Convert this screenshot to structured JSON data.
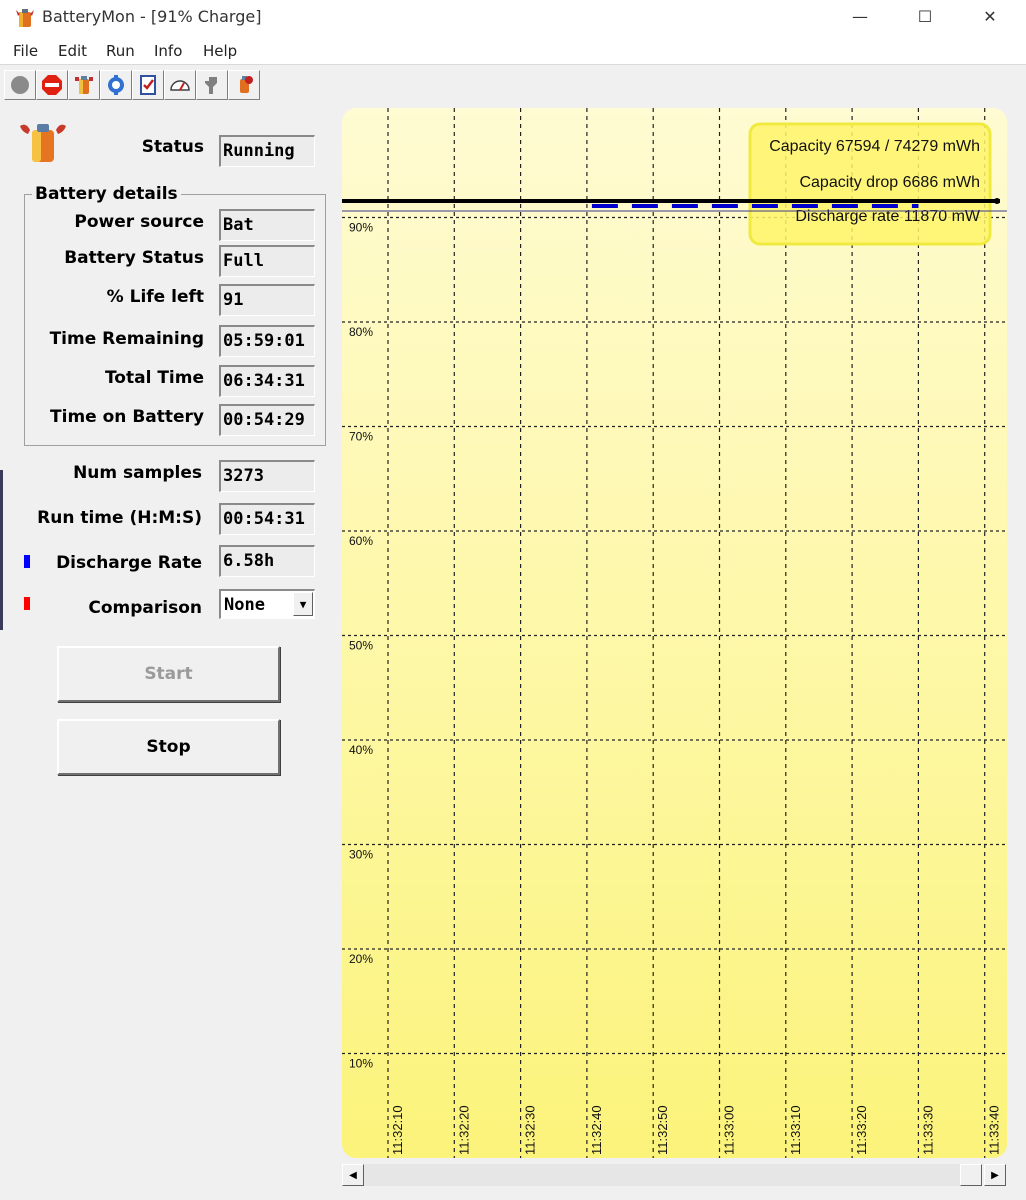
{
  "window": {
    "title": "BatteryMon - [91% Charge]",
    "minimize_glyph": "—",
    "maximize_glyph": "☐",
    "close_glyph": "✕"
  },
  "menu": [
    "File",
    "Edit",
    "Run",
    "Info",
    "Help"
  ],
  "toolbar": [
    "record-icon",
    "stop-icon",
    "battery-icon",
    "settings-icon",
    "checklist-icon",
    "gauge-icon",
    "plug-icon",
    "battery-info-icon"
  ],
  "status": {
    "label": "Status",
    "value": "Running"
  },
  "battery_details": {
    "title": "Battery details",
    "fields": [
      {
        "label": "Power source",
        "value": "Bat"
      },
      {
        "label": "Battery Status",
        "value": "Full"
      },
      {
        "label": "% Life left",
        "value": "91"
      },
      {
        "label": "Time Remaining",
        "value": "05:59:01"
      },
      {
        "label": "Total Time",
        "value": "06:34:31"
      },
      {
        "label": "Time on Battery",
        "value": "00:54:29"
      }
    ]
  },
  "stats": {
    "num_samples": {
      "label": "Num samples",
      "value": "3273"
    },
    "run_time": {
      "label": "Run time (H:M:S)",
      "value": "00:54:31"
    },
    "discharge_rate": {
      "label": "Discharge Rate",
      "value": "6.58h",
      "color": "#0000ff"
    },
    "comparison": {
      "label": "Comparison",
      "value": "None",
      "color": "#ff0000"
    }
  },
  "buttons": {
    "start": "Start",
    "stop": "Stop"
  },
  "colors": {
    "chart_top": "#fffbd2",
    "chart_bottom": "#fbf37a",
    "legend_box": "#fff56a"
  },
  "chart_data": {
    "type": "line",
    "y_ticks": [
      "90%",
      "80%",
      "70%",
      "60%",
      "50%",
      "40%",
      "30%",
      "20%",
      "10%"
    ],
    "y_tick_values": [
      90,
      80,
      70,
      60,
      50,
      40,
      30,
      20,
      10
    ],
    "x_ticks": [
      "11:32:10",
      "11:32:20",
      "11:32:30",
      "11:32:40",
      "11:32:50",
      "11:33:00",
      "11:33:10",
      "11:33:20",
      "11:33:30",
      "11:33:40"
    ],
    "ylim": [
      0,
      100
    ],
    "grid": true,
    "series": [
      {
        "name": "Discharge rate",
        "color": "#0000cc",
        "x": [
          "11:32:40",
          "11:33:30"
        ],
        "values": [
          91,
          91
        ]
      },
      {
        "name": "Capacity",
        "color": "#000000",
        "x": [
          "11:32:10",
          "11:33:40"
        ],
        "values": [
          91,
          91
        ]
      }
    ],
    "annotations": [
      "Capacity 67594 / 74279 mWh",
      "Capacity drop 6686 mWh",
      "Discharge rate 11870 mW"
    ],
    "legend_position": "top-right"
  }
}
